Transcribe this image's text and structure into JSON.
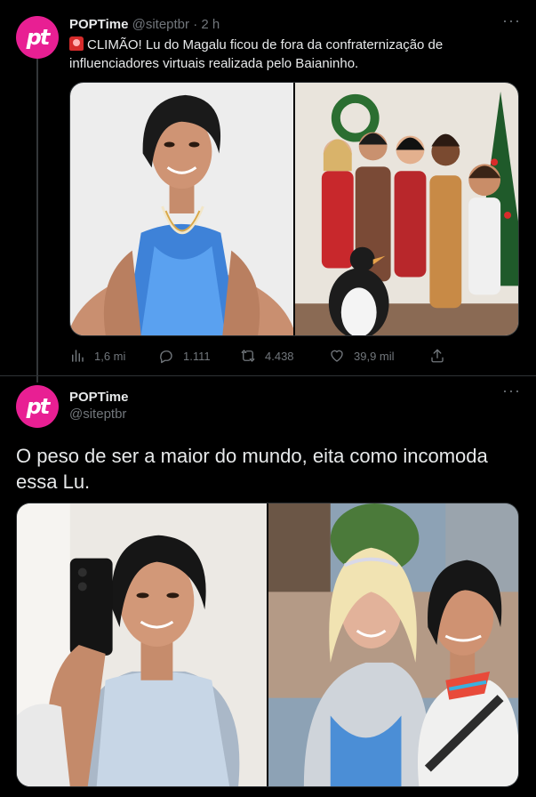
{
  "tweet1": {
    "author_name": "POPTime",
    "author_handle": "@siteptbr",
    "separator": "·",
    "time": "2 h",
    "avatar_text": "pt",
    "text": "CLIMÃO! Lu do Magalu ficou de fora da confraternização de influenciadores virtuais realizada pelo Baianinho.",
    "images": [
      "lu-blue-dress",
      "christmas-group-photo"
    ],
    "stats": {
      "views": "1,6 mi",
      "replies": "1.111",
      "retweets": "4.438",
      "likes": "39,9 mil"
    }
  },
  "tweet2": {
    "author_name": "POPTime",
    "author_handle": "@siteptbr",
    "avatar_text": "pt",
    "text": "O peso de ser a maior do mundo, eita como incomoda essa Lu.",
    "images": [
      "lu-selfie-phone",
      "lu-with-drag-queen"
    ]
  },
  "colors": {
    "background": "#000000",
    "text_primary": "#e7e9ea",
    "text_secondary": "#71767b",
    "avatar_brand": "#e81f93",
    "border": "#2f3336"
  }
}
